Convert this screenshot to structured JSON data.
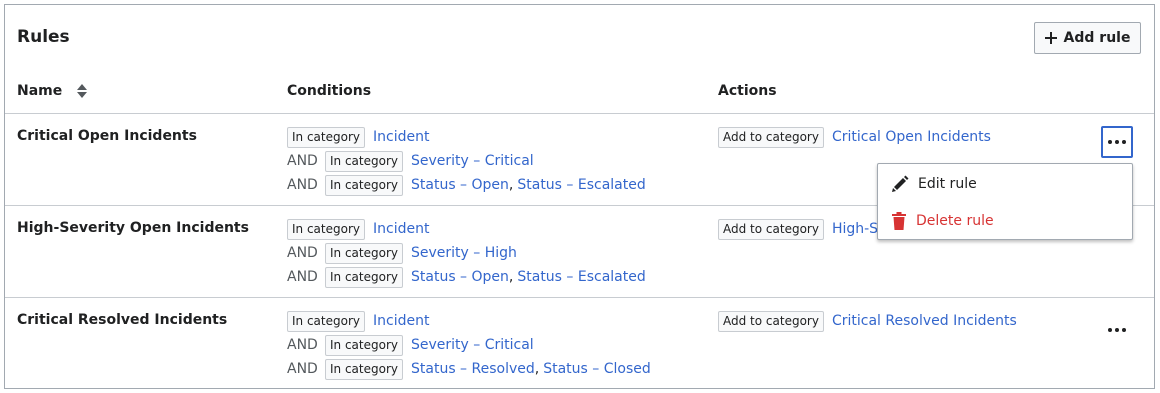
{
  "title": "Rules",
  "add_button": "Add rule",
  "columns": {
    "name": "Name",
    "conditions": "Conditions",
    "actions": "Actions"
  },
  "and_word": "AND",
  "rows": [
    {
      "name": "Critical Open Incidents",
      "conditions": [
        {
          "tag": "In category",
          "links": [
            "Incident"
          ]
        },
        {
          "tag": "In category",
          "links": [
            "Severity – Critical"
          ]
        },
        {
          "tag": "In category",
          "links": [
            "Status – Open",
            "Status – Escalated"
          ]
        }
      ],
      "action": {
        "tag": "Add to category",
        "link": "Critical Open Incidents"
      }
    },
    {
      "name": "High-Severity Open Incidents",
      "conditions": [
        {
          "tag": "In category",
          "links": [
            "Incident"
          ]
        },
        {
          "tag": "In category",
          "links": [
            "Severity – High"
          ]
        },
        {
          "tag": "In category",
          "links": [
            "Status – Open",
            "Status – Escalated"
          ]
        }
      ],
      "action": {
        "tag": "Add to category",
        "link": "High-Severity Open Incidents"
      }
    },
    {
      "name": "Critical Resolved Incidents",
      "conditions": [
        {
          "tag": "In category",
          "links": [
            "Incident"
          ]
        },
        {
          "tag": "In category",
          "links": [
            "Severity – Critical"
          ]
        },
        {
          "tag": "In category",
          "links": [
            "Status – Resolved",
            "Status – Closed"
          ]
        }
      ],
      "action": {
        "tag": "Add to category",
        "link": "Critical Resolved Incidents"
      }
    }
  ],
  "menu": {
    "edit": "Edit rule",
    "delete": "Delete rule"
  },
  "colors": {
    "link": "#3366cc",
    "danger": "#d73333",
    "border": "#a2a9b1"
  },
  "icons": [
    "plus-icon",
    "sort-icon",
    "more-icon",
    "pencil-icon",
    "trash-icon"
  ]
}
